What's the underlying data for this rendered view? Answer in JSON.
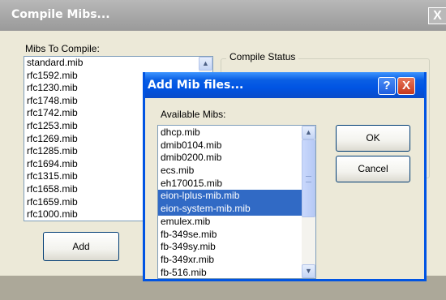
{
  "main_window": {
    "title": "Compile Mibs...",
    "close_glyph": "X",
    "mibs_label": "Mibs To Compile:",
    "mibs": [
      "standard.mib",
      "rfc1592.mib",
      "rfc1230.mib",
      "rfc1748.mib",
      "rfc1742.mib",
      "rfc1253.mib",
      "rfc1269.mib",
      "rfc1285.mib",
      "rfc1694.mib",
      "rfc1315.mib",
      "rfc1658.mib",
      "rfc1659.mib",
      "rfc1000.mib"
    ],
    "status_group_label": "Compile Status",
    "add_button": "Add"
  },
  "add_dialog": {
    "title": "Add Mib files...",
    "help_glyph": "?",
    "close_glyph": "X",
    "available_label": "Available Mibs:",
    "items": [
      {
        "label": "dhcp.mib",
        "selected": false
      },
      {
        "label": "dmib0104.mib",
        "selected": false
      },
      {
        "label": "dmib0200.mib",
        "selected": false
      },
      {
        "label": "ecs.mib",
        "selected": false
      },
      {
        "label": "eh170015.mib",
        "selected": false
      },
      {
        "label": "eion-lplus-mib.mib",
        "selected": true
      },
      {
        "label": "eion-system-mib.mib",
        "selected": true
      },
      {
        "label": "emulex.mib",
        "selected": false
      },
      {
        "label": "fb-349se.mib",
        "selected": false
      },
      {
        "label": "fb-349sy.mib",
        "selected": false
      },
      {
        "label": "fb-349xr.mib",
        "selected": false
      },
      {
        "label": "fb-516.mib",
        "selected": false
      }
    ],
    "ok_button": "OK",
    "cancel_button": "Cancel"
  },
  "icons": {
    "scroll_up": "scroll-up-icon",
    "scroll_down": "scroll-down-icon"
  },
  "colors": {
    "selection": "#316ac5",
    "dialog_title": "#0054e3",
    "inactive_title": "#a8a8a8",
    "window_face": "#ece9d8"
  }
}
